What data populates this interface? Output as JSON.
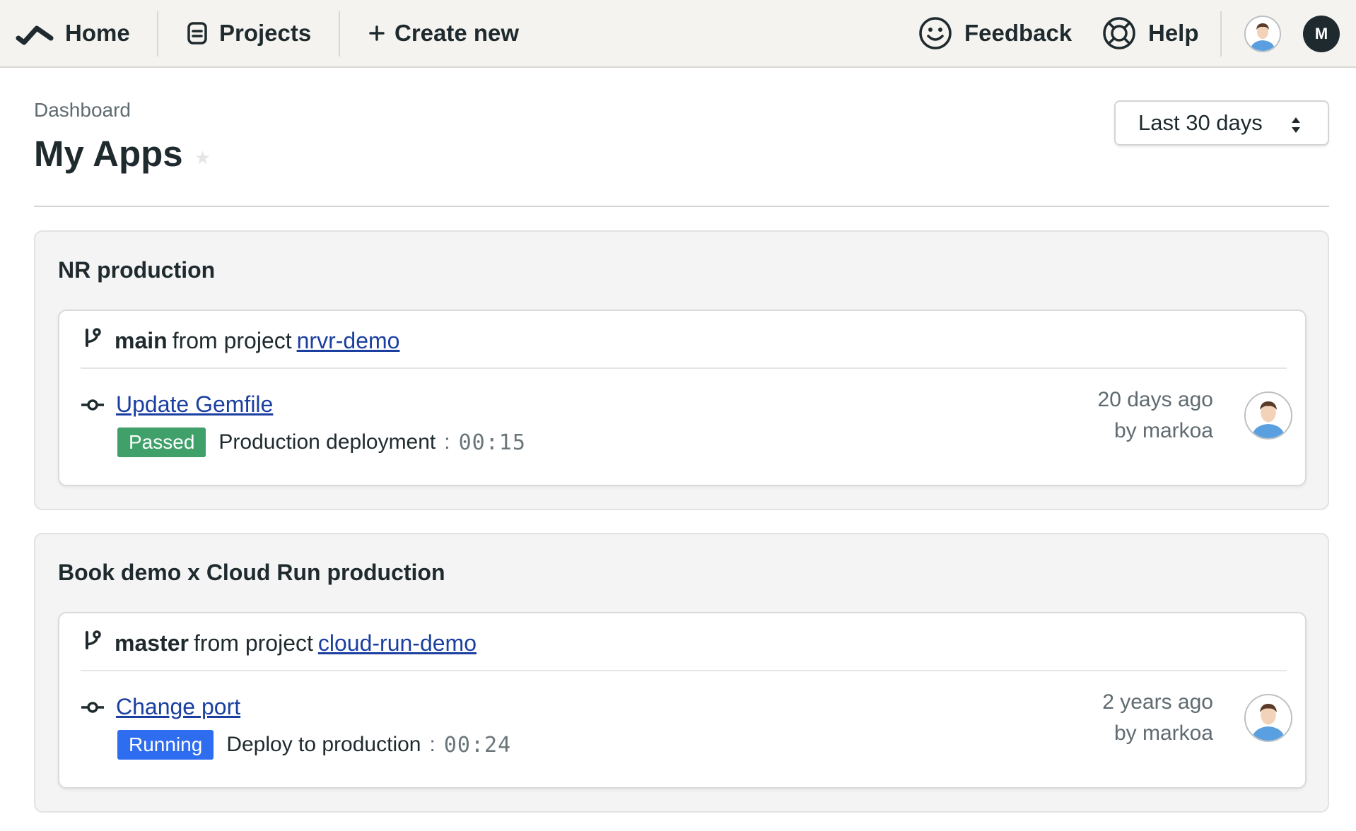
{
  "nav": {
    "home_label": "Home",
    "projects_label": "Projects",
    "create_label": "Create new",
    "feedback_label": "Feedback",
    "help_label": "Help",
    "user_initial": "M"
  },
  "header": {
    "breadcrumb": "Dashboard",
    "title": "My Apps",
    "range_label": "Last 30 days"
  },
  "apps": [
    {
      "name": "NR production",
      "branch": "main",
      "from_text": "from project",
      "project": "nrvr-demo",
      "commit": "Update Gemfile",
      "status": "Passed",
      "pipeline": "Production deployment",
      "separator": ":",
      "duration": "00:15",
      "time_ago": "20 days ago",
      "author": "by markoa"
    },
    {
      "name": "Book demo x Cloud Run production",
      "branch": "master",
      "from_text": "from project",
      "project": "cloud-run-demo",
      "commit": "Change port",
      "status": "Running",
      "pipeline": "Deploy to production",
      "separator": ":",
      "duration": "00:24",
      "time_ago": "2 years ago",
      "author": "by markoa"
    }
  ],
  "colors": {
    "passed": "#40a06a",
    "running": "#2e6cf0",
    "link": "#1a3fa0",
    "topbar": "#f4f3ef"
  },
  "icons": [
    "semaphore-logo-icon",
    "projects-icon",
    "plus-icon",
    "smiley-icon",
    "lifebuoy-icon",
    "branch-icon",
    "commit-icon",
    "updown-arrows-icon",
    "star-icon"
  ]
}
